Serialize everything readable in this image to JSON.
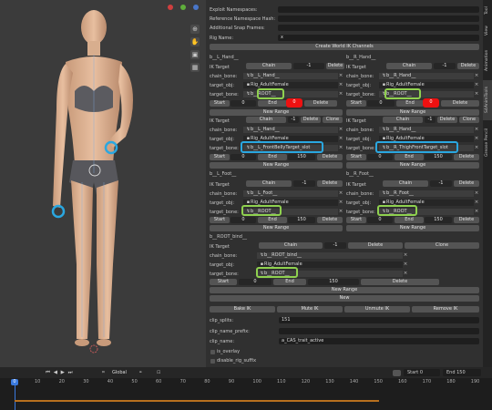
{
  "viewport": {
    "right_tabs": [
      "Tool",
      "View",
      "Animation",
      "S4AnimTools",
      "Grease Pencil"
    ],
    "tools": [
      "hand-icon",
      "camera-icon",
      "grid-icon"
    ]
  },
  "fields": {
    "exploit_label": "Exploit Namespaces:",
    "refhash_label": "Reference Namespace Hash:",
    "snap_label": "Additional Snap Frames:",
    "rigname_label": "Rig Name:",
    "rigname_value": "x",
    "create_btn": "Create World IK Channels"
  },
  "left_hand": {
    "title": "b__L_Hand__",
    "ik_target": "IK Target",
    "chain": "Chain",
    "chain_val": "-1",
    "delete": "Delete",
    "chain_bone_label": "chain_bone:",
    "chain_bone": "b__L_Hand__",
    "target_obj_label": "target_obj:",
    "target_obj": "Rig_AdultFemale",
    "target_bone_label": "target_bone:",
    "target_bone": "b__ROOT__",
    "start": "Start",
    "start_val": "0",
    "end": "End",
    "end_val": "0",
    "new_range": "New Range",
    "ik2_chain_val": "-1",
    "clone": "Clone",
    "chain2_bone": "b__L_Hand__",
    "target2_obj": "Rig_AdultFemale",
    "target2_bone": "b__L_FrontBellyTarget_slot",
    "start2_val": "0",
    "end2_val": "150"
  },
  "right_hand": {
    "title": "b__R_Hand__",
    "chain_val": "-1",
    "chain_bone": "b__R_Hand__",
    "target_obj": "Rig_AdultFemale",
    "target_bone": "b__ROOT__",
    "start_val": "0",
    "end_val": "0",
    "chain2_val": "-1",
    "chain2_bone": "b__R_Hand__",
    "target2_obj": "Rig_AdultFemale",
    "target2_bone": "b__R_ThighFrontTarget_slot",
    "start2_val": "0",
    "end2_val": "150"
  },
  "left_foot": {
    "title": "b__L_Foot__",
    "chain_val": "-1",
    "chain_bone": "b__L_Foot__",
    "target_obj": "Rig_AdultFemale",
    "target_bone": "b__ROOT__",
    "start_val": "0",
    "end_val": "150"
  },
  "right_foot": {
    "title": "b__R_Foot__",
    "chain_val": "-1",
    "chain_bone": "b__R_Foot__",
    "target_obj": "Rig_AdultFemale",
    "target_bone": "b__ROOT__",
    "start_val": "0",
    "end_val": "150"
  },
  "root_bind": {
    "title": "b__ROOT_bind__",
    "chain_val": "-1",
    "chain_bone": "b__ROOT_bind__",
    "target_obj": "Rig_AdultFemale",
    "target_bone": "b__ROOT__",
    "start_val": "0",
    "end_val": "150",
    "new": "New"
  },
  "actions": {
    "bake": "Bake IK",
    "mute": "Mute IK",
    "unmute": "Unmute IK",
    "remove": "Remove IK"
  },
  "clip": {
    "splits_label": "clip_splits:",
    "splits_value": "151",
    "prefix_label": "clip_name_prefix:",
    "name_label": "clip_name:",
    "name_value": "a_CAS_trait_active",
    "overlay_label": "is_overlay",
    "suffix_label": "disable_rig_suffix"
  },
  "footer": {
    "global": "Global",
    "start_label": "Start",
    "start_val": "0",
    "end_label": "End",
    "end_val": "150"
  },
  "timeline": {
    "current_frame": "0",
    "ticks": [
      "10",
      "20",
      "30",
      "40",
      "50",
      "60",
      "70",
      "80",
      "90",
      "100",
      "110",
      "120",
      "130",
      "140",
      "150",
      "160",
      "170",
      "180",
      "190"
    ]
  }
}
